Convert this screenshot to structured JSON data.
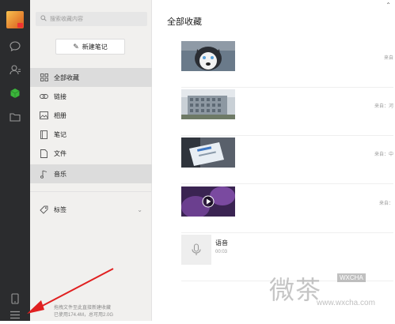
{
  "search": {
    "placeholder": "搜索收藏内容"
  },
  "new_note_label": "新建笔记",
  "nav": {
    "items": [
      {
        "label": "全部收藏",
        "icon": "grid-icon",
        "active": true
      },
      {
        "label": "链接",
        "icon": "link-icon"
      },
      {
        "label": "相册",
        "icon": "image-icon"
      },
      {
        "label": "笔记",
        "icon": "note-icon"
      },
      {
        "label": "文件",
        "icon": "file-icon"
      },
      {
        "label": "音乐",
        "icon": "music-icon"
      }
    ],
    "tags_label": "标签"
  },
  "storage": {
    "line1": "拖拽文件至此直接新建收藏",
    "line2": "已使用174.4M，总可用2.0G"
  },
  "main": {
    "title": "全部收藏",
    "items": [
      {
        "type": "image",
        "thumb": "husky-dog",
        "source": "来自"
      },
      {
        "type": "image",
        "thumb": "building",
        "source": "来自：河"
      },
      {
        "type": "image",
        "thumb": "card-photo",
        "source": "来自：中"
      },
      {
        "type": "video",
        "thumb": "purple-video",
        "source": "来自："
      },
      {
        "type": "voice",
        "title": "语音",
        "duration": "00:03"
      }
    ]
  },
  "watermark": {
    "text": "微茶",
    "badge": "WXCHA",
    "url": "www.wxcha.com"
  },
  "colors": {
    "rail": "#2b2c2e",
    "nav_bg": "#f1f0ee",
    "active_green": "#3bb63b",
    "arrow_red": "#e02020"
  }
}
